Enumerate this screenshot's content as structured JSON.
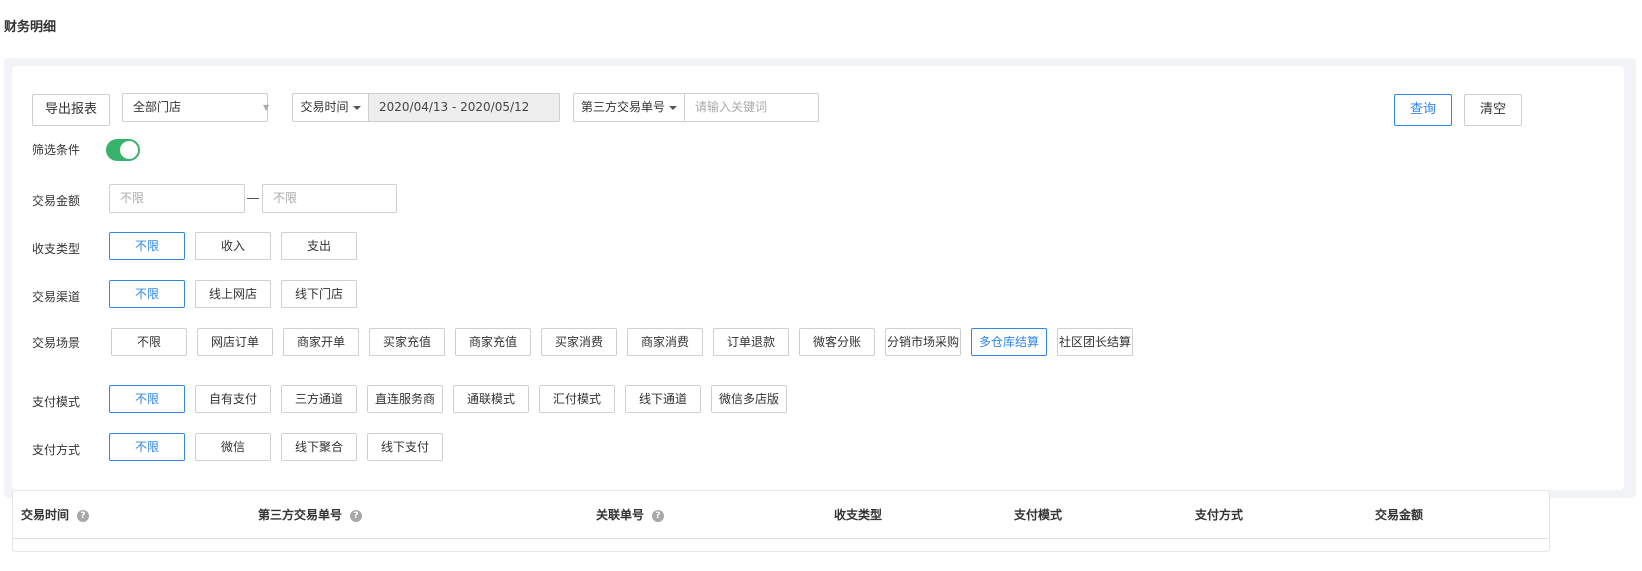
{
  "page": {
    "title": "财务明细"
  },
  "toolbar": {
    "export_label": "导出报表",
    "store_select": "全部门店",
    "time_type_label": "交易时间",
    "date_range": "2020/04/13 - 2020/05/12",
    "keyword_type_label": "第三方交易单号",
    "keyword_placeholder": "请输入关键词",
    "query_label": "查询",
    "clear_label": "清空"
  },
  "filters": {
    "toggle_label": "筛选条件",
    "toggle_on": true,
    "amount": {
      "label": "交易金额",
      "min_placeholder": "不限",
      "max_placeholder": "不限"
    },
    "income_type": {
      "label": "收支类型",
      "options": [
        "不限",
        "收入",
        "支出"
      ],
      "selected": 0
    },
    "channel": {
      "label": "交易渠道",
      "options": [
        "不限",
        "线上网店",
        "线下门店"
      ],
      "selected": 0
    },
    "scene": {
      "label": "交易场景",
      "options": [
        "不限",
        "网店订单",
        "商家开单",
        "买家充值",
        "商家充值",
        "买家消费",
        "商家消费",
        "订单退款",
        "微客分账",
        "分销市场采购",
        "多仓库结算",
        "社区团长结算"
      ],
      "selected": 10
    },
    "pay_mode": {
      "label": "支付模式",
      "options": [
        "不限",
        "自有支付",
        "三方通道",
        "直连服务商",
        "通联模式",
        "汇付模式",
        "线下通道",
        "微信多店版"
      ],
      "selected": 0
    },
    "pay_method": {
      "label": "支付方式",
      "options": [
        "不限",
        "微信",
        "线下聚合",
        "线下支付"
      ],
      "selected": 0
    }
  },
  "table": {
    "columns": [
      "交易时间",
      "第三方交易单号",
      "关联单号",
      "收支类型",
      "支付模式",
      "支付方式",
      "交易金额"
    ]
  },
  "colors": {
    "accent": "#2f87ea",
    "toggle": "#36b26a"
  }
}
